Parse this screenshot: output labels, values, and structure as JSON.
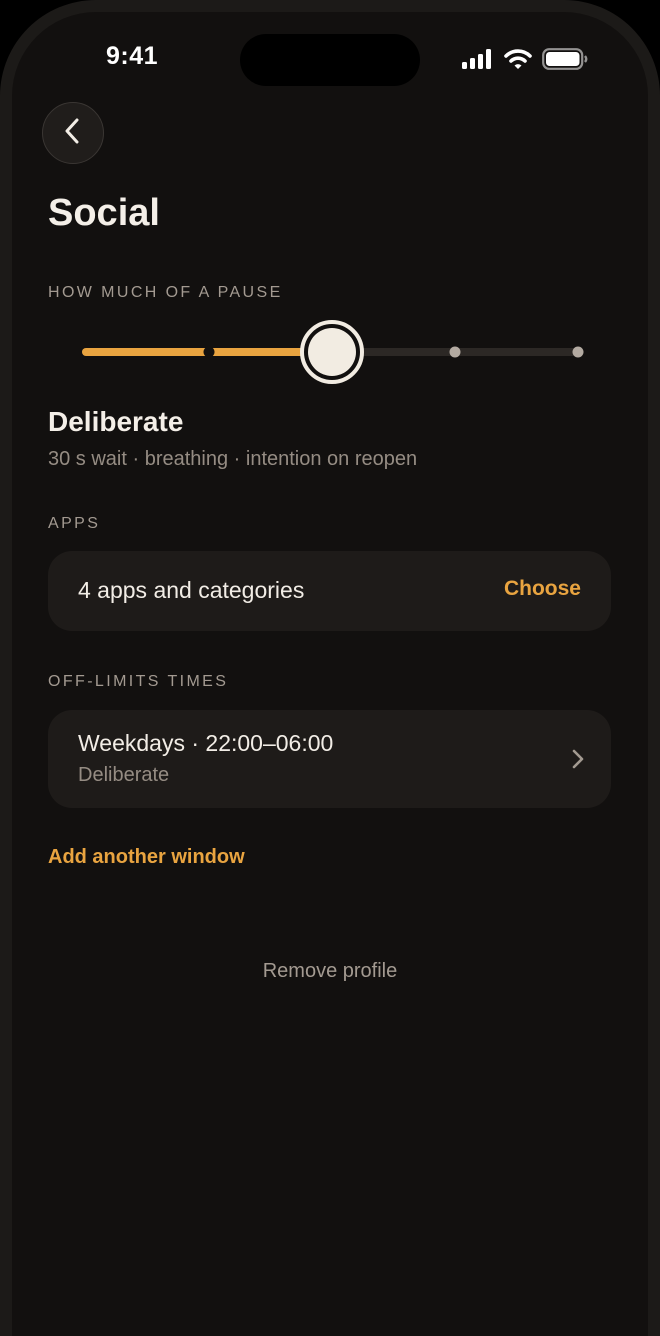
{
  "status_bar": {
    "time": "9:41",
    "icons": [
      "cellular-signal-icon",
      "wifi-icon",
      "battery-icon"
    ]
  },
  "header": {
    "back_icon": "chevron-left-icon",
    "title": "Social"
  },
  "pause": {
    "section_label": "HOW MUCH OF A PAUSE",
    "levels_count": 5,
    "selected_level_index": 2,
    "selected_name": "Deliberate",
    "selected_description": "30 s wait · breathing · intention on reopen"
  },
  "apps": {
    "section_label": "APPS",
    "summary": "4 apps and categories",
    "choose_label": "Choose"
  },
  "off_limits": {
    "section_label": "OFF-LIMITS TIMES",
    "windows": [
      {
        "title": "Weekdays · 22:00–06:00",
        "level": "Deliberate"
      }
    ],
    "add_label": "Add another window"
  },
  "footer": {
    "remove_label": "Remove profile"
  },
  "colors": {
    "accent": "#e9a440",
    "background": "#12100f",
    "card": "#1e1b19",
    "track": "#2c2825",
    "thumb": "#f2ece2"
  }
}
